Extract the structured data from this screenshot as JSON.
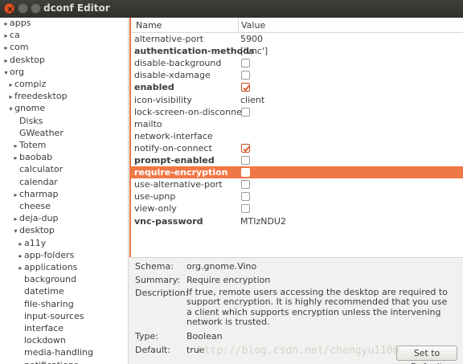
{
  "window": {
    "title": "dconf Editor"
  },
  "tree": [
    {
      "label": "apps",
      "level": 0,
      "expander": "collapsed"
    },
    {
      "label": "ca",
      "level": 0,
      "expander": "collapsed"
    },
    {
      "label": "com",
      "level": 0,
      "expander": "collapsed"
    },
    {
      "label": "desktop",
      "level": 0,
      "expander": "collapsed"
    },
    {
      "label": "org",
      "level": 0,
      "expander": "expanded"
    },
    {
      "label": "compiz",
      "level": 1,
      "expander": "collapsed"
    },
    {
      "label": "freedesktop",
      "level": 1,
      "expander": "collapsed"
    },
    {
      "label": "gnome",
      "level": 1,
      "expander": "expanded"
    },
    {
      "label": "Disks",
      "level": 2,
      "expander": "none"
    },
    {
      "label": "GWeather",
      "level": 2,
      "expander": "none"
    },
    {
      "label": "Totem",
      "level": 2,
      "expander": "collapsed"
    },
    {
      "label": "baobab",
      "level": 2,
      "expander": "collapsed"
    },
    {
      "label": "calculator",
      "level": 2,
      "expander": "none"
    },
    {
      "label": "calendar",
      "level": 2,
      "expander": "none"
    },
    {
      "label": "charmap",
      "level": 2,
      "expander": "collapsed"
    },
    {
      "label": "cheese",
      "level": 2,
      "expander": "none"
    },
    {
      "label": "deja-dup",
      "level": 2,
      "expander": "collapsed"
    },
    {
      "label": "desktop",
      "level": 2,
      "expander": "expanded"
    },
    {
      "label": "a11y",
      "level": 3,
      "expander": "collapsed"
    },
    {
      "label": "app-folders",
      "level": 3,
      "expander": "collapsed"
    },
    {
      "label": "applications",
      "level": 3,
      "expander": "collapsed"
    },
    {
      "label": "background",
      "level": 3,
      "expander": "none"
    },
    {
      "label": "datetime",
      "level": 3,
      "expander": "none"
    },
    {
      "label": "file-sharing",
      "level": 3,
      "expander": "none"
    },
    {
      "label": "input-sources",
      "level": 3,
      "expander": "none"
    },
    {
      "label": "interface",
      "level": 3,
      "expander": "none"
    },
    {
      "label": "lockdown",
      "level": 3,
      "expander": "none"
    },
    {
      "label": "media-handling",
      "level": 3,
      "expander": "none"
    },
    {
      "label": "notifications",
      "level": 3,
      "expander": "none"
    }
  ],
  "table": {
    "col_name": "Name",
    "col_value": "Value",
    "rows": [
      {
        "name": "alternative-port",
        "bold": false,
        "type": "text",
        "value": "5900"
      },
      {
        "name": "authentication-methods",
        "bold": true,
        "type": "text",
        "value": "['vnc']"
      },
      {
        "name": "disable-background",
        "bold": false,
        "type": "check",
        "checked": false
      },
      {
        "name": "disable-xdamage",
        "bold": false,
        "type": "check",
        "checked": false
      },
      {
        "name": "enabled",
        "bold": true,
        "type": "check",
        "checked": true
      },
      {
        "name": "icon-visibility",
        "bold": false,
        "type": "text",
        "value": "client"
      },
      {
        "name": "lock-screen-on-disconnect",
        "bold": false,
        "type": "check",
        "checked": false
      },
      {
        "name": "mailto",
        "bold": false,
        "type": "text",
        "value": ""
      },
      {
        "name": "network-interface",
        "bold": false,
        "type": "text",
        "value": ""
      },
      {
        "name": "notify-on-connect",
        "bold": false,
        "type": "check",
        "checked": true
      },
      {
        "name": "prompt-enabled",
        "bold": true,
        "type": "check",
        "checked": false
      },
      {
        "name": "require-encryption",
        "bold": true,
        "type": "check",
        "checked": false,
        "selected": true
      },
      {
        "name": "use-alternative-port",
        "bold": false,
        "type": "check",
        "checked": false
      },
      {
        "name": "use-upnp",
        "bold": false,
        "type": "check",
        "checked": false
      },
      {
        "name": "view-only",
        "bold": false,
        "type": "check",
        "checked": false
      },
      {
        "name": "vnc-password",
        "bold": true,
        "type": "text",
        "value": "MTIzNDU2"
      }
    ]
  },
  "details": {
    "schema_label": "Schema:",
    "schema_value": "org.gnome.Vino",
    "summary_label": "Summary:",
    "summary_value": "Require encryption",
    "description_label": "Description:",
    "description_value": "If true, remote users accessing the desktop are required to support encryption. It is highly recommended that you use a client which supports encryption unless the intervening network is trusted.",
    "type_label": "Type:",
    "type_value": "Boolean",
    "default_label": "Default:",
    "default_value": "true",
    "reset_button": "Set to Default"
  },
  "watermark": "http://blog.csdn.net/chengyu1100",
  "colors": {
    "accent": "#f07746",
    "titlebar": "#3c3b37",
    "close_button": "#e25425"
  }
}
